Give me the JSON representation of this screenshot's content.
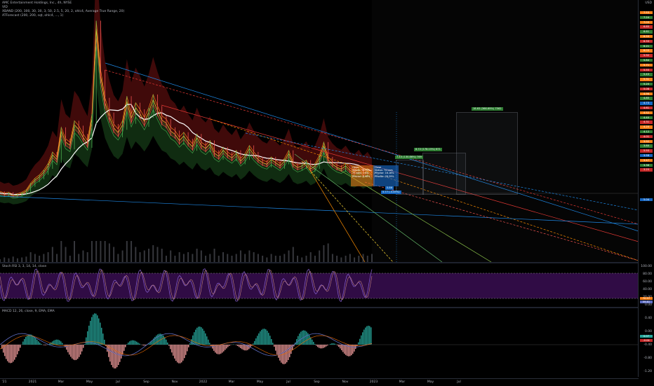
{
  "legend": {
    "symbol_line": "AMC Entertainment Holdings, Inc., 4h, NYSE",
    "line2": "VID",
    "line3": "XBAND (200, 300, 30, 30, 3, 50, 2.5, 5, 20, 2, ohlc4, Average True Range, 20)",
    "line4": "ATForecast (200, 200, sqt, ohlc4, ..., 1)"
  },
  "rsi": {
    "label": "Stoch RSI 3, 3, 14, 14, close",
    "ticks": [
      "100.00",
      "80.00",
      "60.00",
      "40.00",
      "20.00",
      "0.00"
    ],
    "value_tags": [
      "70.97",
      "59.81"
    ]
  },
  "macd": {
    "label": "MACD 12, 26, close, 9, EMA, EMA",
    "ticks": [
      "0.40",
      "0.00",
      "-0.40",
      "-0.80",
      "-1.20"
    ],
    "value_tags": [
      "0.07",
      "-0.04"
    ]
  },
  "price_axis": {
    "top_label": "USD",
    "tags": [
      {
        "t": "7.53",
        "c": "#f57f17"
      },
      {
        "t": "7.24",
        "c": "#2e7d32"
      },
      {
        "t": "7.03",
        "c": "#f57f17"
      },
      {
        "t": "6.85",
        "c": "#c62828"
      },
      {
        "t": "6.61",
        "c": "#2e7d32"
      },
      {
        "t": "6.50",
        "c": "#f57f17"
      },
      {
        "t": "6.33",
        "c": "#c62828"
      },
      {
        "t": "6.21",
        "c": "#2e7d32"
      },
      {
        "t": "6.03",
        "c": "#f57f17"
      },
      {
        "t": "5.92",
        "c": "#c62828"
      },
      {
        "t": "5.84",
        "c": "#2e7d32"
      },
      {
        "t": "5.71",
        "c": "#f57f17"
      },
      {
        "t": "5.55",
        "c": "#c62828"
      },
      {
        "t": "5.43",
        "c": "#2e7d32"
      },
      {
        "t": "5.31",
        "c": "#f57f17"
      },
      {
        "t": "5.20",
        "c": "#2e7d32"
      },
      {
        "t": "5.08",
        "c": "#c62828"
      },
      {
        "t": "4.96",
        "c": "#f57f17"
      },
      {
        "t": "4.85",
        "c": "#2e7d32"
      },
      {
        "t": "4.73",
        "c": "#1565c0"
      },
      {
        "t": "4.61",
        "c": "#c62828"
      },
      {
        "t": "4.52",
        "c": "#f57f17"
      },
      {
        "t": "4.40",
        "c": "#2e7d32"
      },
      {
        "t": "4.31",
        "c": "#c62828"
      },
      {
        "t": "4.20",
        "c": "#f57f17"
      },
      {
        "t": "4.12",
        "c": "#2e7d32"
      },
      {
        "t": "4.01",
        "c": "#c62828"
      },
      {
        "t": "3.92",
        "c": "#f57f17"
      },
      {
        "t": "3.80",
        "c": "#2e7d32"
      },
      {
        "t": "3.69",
        "c": "#c62828"
      },
      {
        "t": "3.58",
        "c": "#1565c0"
      },
      {
        "t": "3.47",
        "c": "#f57f17"
      },
      {
        "t": "3.36",
        "c": "#2e7d32"
      },
      {
        "t": "3.25",
        "c": "#c62828"
      }
    ],
    "last_price": "5.93",
    "current": "5.04"
  },
  "targets": [
    {
      "label": "18.63 (366.69%) 7562"
    },
    {
      "label": "8.72 (178.15%) 671"
    },
    {
      "label": "7.43 (130.86%) 769"
    },
    {
      "label": "5.86"
    },
    {
      "label": "5.77 (-5.49%)"
    }
  ],
  "info_boxes": {
    "left": "Open\nStatus: 76.37%\n77 bars: 7.8%\nPFactor: 8.98%",
    "right": "Close\nStatus: 74 bars\nPFactor: 16.16%\nPFactor: 28.29%"
  },
  "x_axis": [
    "'21",
    "2021",
    "Mar",
    "May",
    "Jul",
    "Sep",
    "Nov",
    "2022",
    "Mar",
    "May",
    "Jul",
    "Sep",
    "Nov",
    "2023",
    "Mar",
    "May",
    "Jul"
  ],
  "price_series": [
    2.1,
    2.0,
    2.05,
    1.9,
    1.95,
    2.05,
    2.2,
    2.6,
    2.9,
    3.1,
    3.4,
    3.8,
    4.5,
    4.2,
    6.0,
    5.3,
    5.1,
    6.4,
    6.1,
    5.6,
    5.2,
    6.8,
    12.5,
    9.5,
    7.8,
    6.9,
    6.2,
    5.9,
    6.4,
    7.9,
    6.8,
    7.5,
    7.1,
    6.6,
    7.2,
    8.0,
    7.3,
    6.7,
    6.5,
    6.0,
    5.8,
    5.4,
    5.7,
    5.3,
    5.0,
    5.6,
    5.1,
    4.9,
    5.2,
    4.6,
    4.4,
    4.8,
    4.5,
    4.3,
    4.6,
    4.1,
    4.4,
    4.9,
    4.5,
    4.2,
    4.0,
    3.9,
    4.2,
    4.0,
    3.8,
    4.1,
    4.6,
    3.9,
    3.7,
    3.8,
    4.0,
    3.6,
    3.8,
    4.3,
    5.1,
    4.2,
    3.9,
    3.7,
    3.6,
    3.8,
    3.5,
    3.4,
    3.6,
    3.3,
    3.5,
    3.2
  ]
}
